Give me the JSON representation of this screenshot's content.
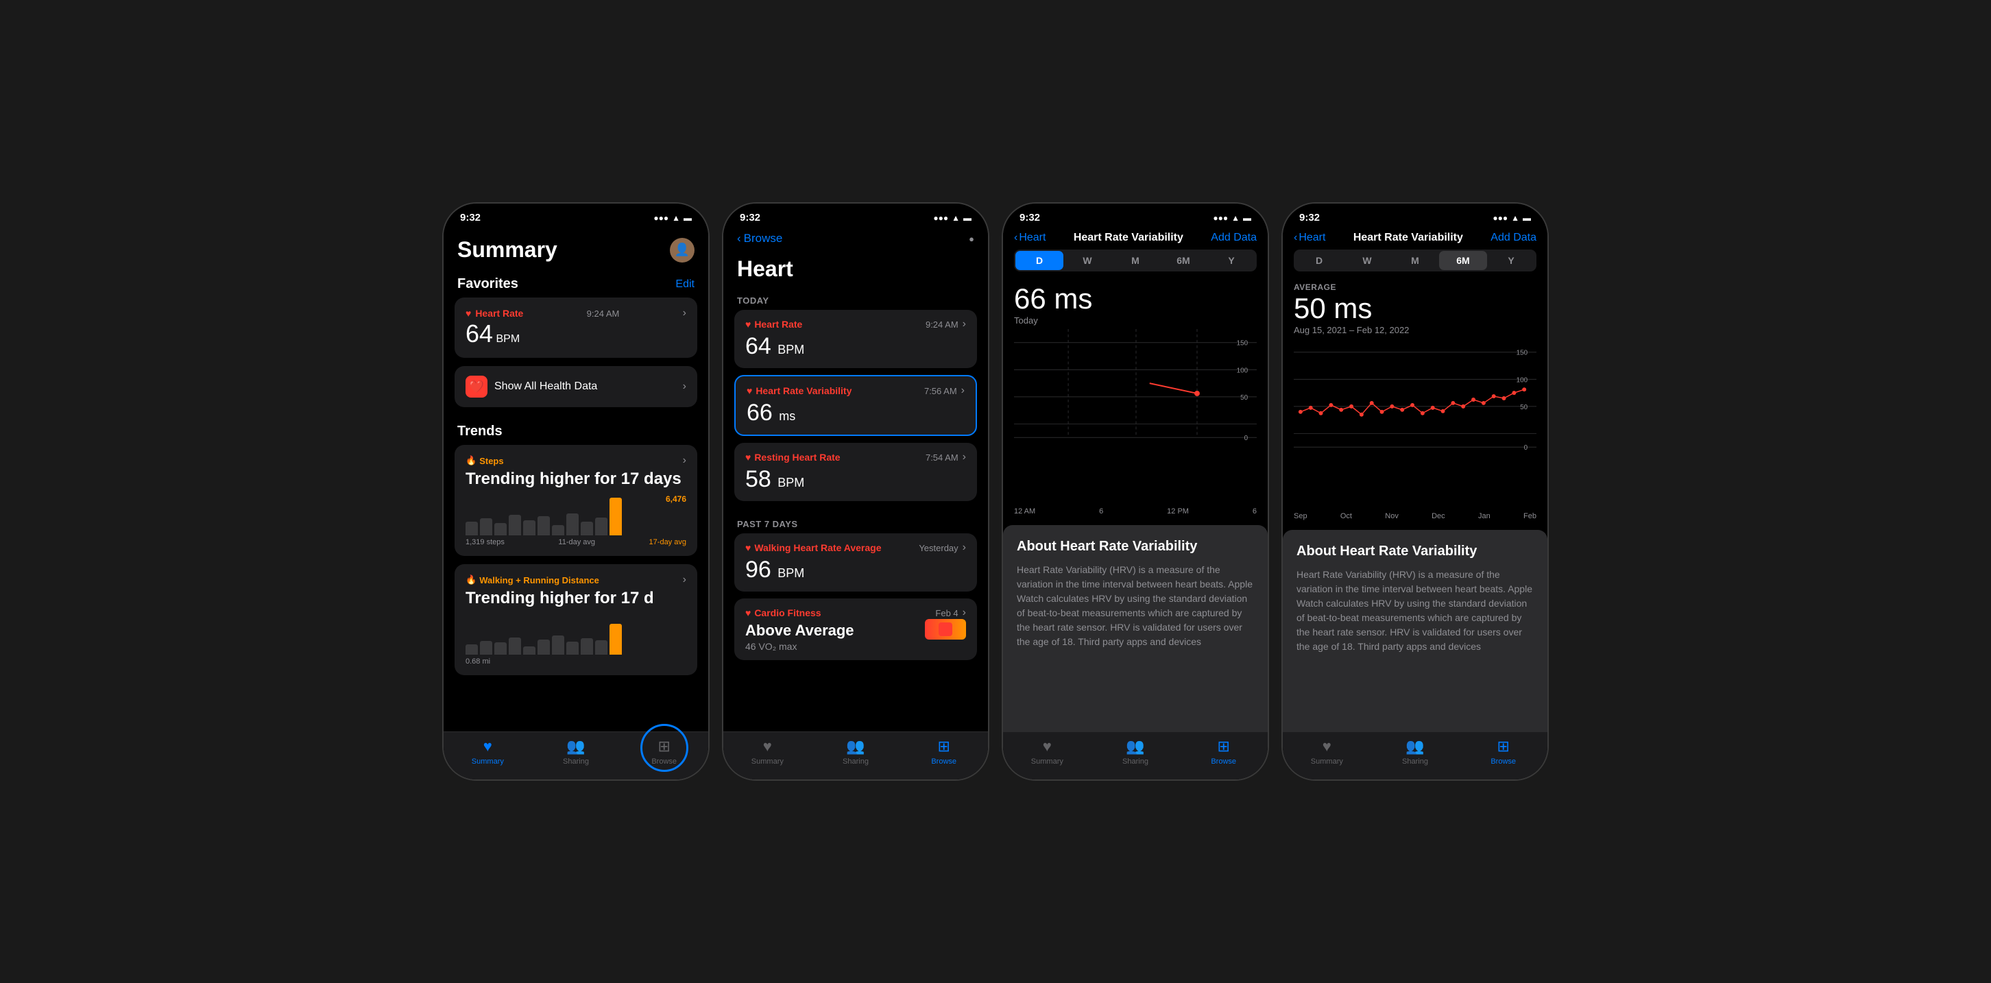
{
  "phones": [
    {
      "id": "phone1",
      "statusBar": {
        "time": "9:32",
        "signal": "●●●",
        "wifi": "WiFi",
        "battery": "🔋"
      },
      "screen": "summary",
      "summary": {
        "title": "Summary",
        "favoritesLabel": "Favorites",
        "editLabel": "Edit",
        "heartRateLabel": "Heart Rate",
        "heartRateTime": "9:24 AM",
        "heartRateValue": "64",
        "heartRateUnit": "BPM",
        "showAllLabel": "Show All Health Data",
        "trendsLabel": "Trends",
        "trend1Category": "Steps",
        "trend1Text": "Trending higher for 17 days",
        "trend1Avg1": "1,319 steps",
        "trend1Avg2": "11-day avg",
        "trend1Avg3": "17-day avg",
        "trend1Peak": "6,476",
        "trend2Category": "Walking + Running Distance",
        "trend2Text": "Trending higher for 17 d",
        "trend2Value": "0.68 mi"
      },
      "tabBar": {
        "items": [
          {
            "label": "Summary",
            "icon": "♥",
            "active": true
          },
          {
            "label": "Sharing",
            "icon": "👥",
            "active": false
          },
          {
            "label": "Browse",
            "icon": "⊞",
            "active": false
          }
        ]
      }
    },
    {
      "id": "phone2",
      "statusBar": {
        "time": "9:32"
      },
      "screen": "heart",
      "heart": {
        "backLabel": "Browse",
        "pageTitle": "Heart",
        "todayLabel": "Today",
        "heartRateLabel": "Heart Rate",
        "heartRateTime": "9:24 AM",
        "heartRateValue": "64",
        "heartRateUnit": "BPM",
        "hrvLabel": "Heart Rate Variability",
        "hrvTime": "7:56 AM",
        "hrvValue": "66",
        "hrvUnit": "ms",
        "restingLabel": "Resting Heart Rate",
        "restingTime": "7:54 AM",
        "restingValue": "58",
        "restingUnit": "BPM",
        "past7Label": "Past 7 Days",
        "walkingLabel": "Walking Heart Rate Average",
        "walkingTime": "Yesterday",
        "walkingValue": "96",
        "walkingUnit": "BPM",
        "cardioLabel": "Cardio Fitness",
        "cardioTime": "Feb 4",
        "cardioText": "Above Average",
        "cardioValue": "46 VO₂ max"
      },
      "tabBar": {
        "items": [
          {
            "label": "Summary",
            "icon": "♥",
            "active": false
          },
          {
            "label": "Sharing",
            "icon": "👥",
            "active": false
          },
          {
            "label": "Browse",
            "icon": "⊞",
            "active": true
          }
        ]
      }
    },
    {
      "id": "phone3",
      "statusBar": {
        "time": "9:32"
      },
      "screen": "hrv-day",
      "hrv": {
        "backLabel": "Heart",
        "pageTitle": "Heart Rate Variability",
        "addDataLabel": "Add Data",
        "timePeriods": [
          "D",
          "W",
          "M",
          "6M",
          "Y"
        ],
        "activeTimePeriod": "D",
        "avgLabel": "66 ms",
        "avgSublabel": "Today",
        "chartYLabels": [
          "150",
          "100",
          "50",
          "0"
        ],
        "chartXLabels": [
          "12 AM",
          "6",
          "12 PM",
          "6"
        ],
        "aboutTitle": "About Heart Rate Variability",
        "aboutText": "Heart Rate Variability (HRV) is a measure of the variation in the time interval between heart beats. Apple Watch calculates HRV by using the standard deviation of beat-to-beat measurements which are captured by the heart rate sensor. HRV is validated for users over the age of 18. Third party apps and devices"
      },
      "tabBar": {
        "items": [
          {
            "label": "Summary",
            "icon": "♥",
            "active": false
          },
          {
            "label": "Sharing",
            "icon": "👥",
            "active": false
          },
          {
            "label": "Browse",
            "icon": "⊞",
            "active": true
          }
        ]
      }
    },
    {
      "id": "phone4",
      "statusBar": {
        "time": "9:32"
      },
      "screen": "hrv-6m",
      "hrv": {
        "backLabel": "Heart",
        "pageTitle": "Heart Rate Variability",
        "addDataLabel": "Add Data",
        "timePeriods": [
          "D",
          "W",
          "M",
          "6M",
          "Y"
        ],
        "activeTimePeriod": "6M",
        "avgLabel": "AVERAGE",
        "mainValue": "50 ms",
        "dateRange": "Aug 15, 2021 – Feb 12, 2022",
        "chartYLabels": [
          "150",
          "100",
          "50",
          "0"
        ],
        "chartXLabels": [
          "Sep",
          "Oct",
          "Nov",
          "Dec",
          "Jan",
          "Feb"
        ],
        "aboutTitle": "About Heart Rate Variability",
        "aboutText": "Heart Rate Variability (HRV) is a measure of the variation in the time interval between heart beats. Apple Watch calculates HRV by using the standard deviation of beat-to-beat measurements which are captured by the heart rate sensor. HRV is validated for users over the age of 18. Third party apps and devices"
      },
      "tabBar": {
        "items": [
          {
            "label": "Summary",
            "icon": "♥",
            "active": false
          },
          {
            "label": "Sharing",
            "icon": "👥",
            "active": false
          },
          {
            "label": "Browse",
            "icon": "⊞",
            "active": true
          }
        ]
      }
    }
  ],
  "colors": {
    "accent": "#007aff",
    "red": "#ff3b30",
    "orange": "#ff9500",
    "darkBg": "#000000",
    "cardBg": "#1c1c1e",
    "textPrimary": "#ffffff",
    "textSecondary": "#8e8e93"
  }
}
